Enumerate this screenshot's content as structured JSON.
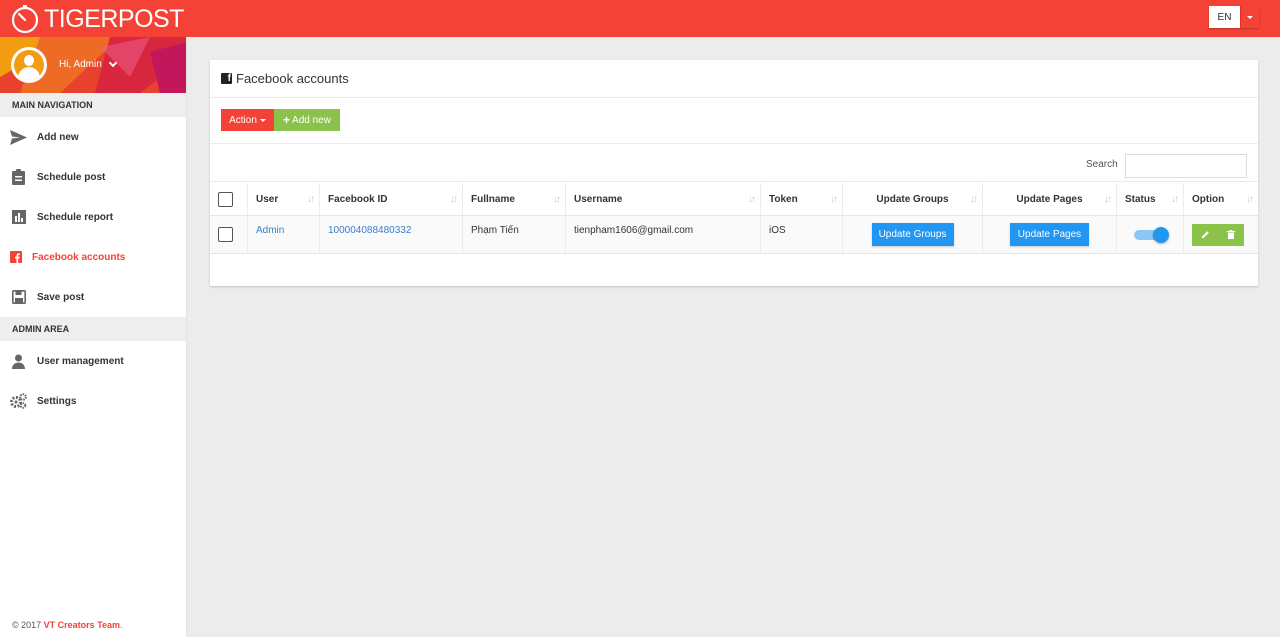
{
  "app": {
    "logo_text": "TIGERPOST",
    "language": "EN"
  },
  "user": {
    "greeting": "Hi, Admin"
  },
  "sidebar": {
    "main_header": "MAIN NAVIGATION",
    "main_items": [
      {
        "label": "Add new",
        "icon": "paper-plane-icon"
      },
      {
        "label": "Schedule post",
        "icon": "clipboard-icon"
      },
      {
        "label": "Schedule report",
        "icon": "bar-chart-icon"
      },
      {
        "label": "Facebook accounts",
        "icon": "facebook-icon",
        "active": true
      },
      {
        "label": "Save post",
        "icon": "floppy-disk-icon"
      }
    ],
    "admin_header": "ADMIN AREA",
    "admin_items": [
      {
        "label": "User management",
        "icon": "user-icon"
      },
      {
        "label": "Settings",
        "icon": "gears-icon"
      }
    ],
    "footer_prefix": "© 2017",
    "footer_brand": "VT Creators Team",
    "footer_suffix": "."
  },
  "page": {
    "title": "Facebook accounts",
    "action_label": "Action",
    "add_new_label": "Add new",
    "search_label": "Search",
    "search_value": ""
  },
  "table": {
    "columns": [
      "User",
      "Facebook ID",
      "Fullname",
      "Username",
      "Token",
      "Update Groups",
      "Update Pages",
      "Status",
      "Option"
    ],
    "rows": [
      {
        "user": "Admin",
        "facebook_id": "100004088480332",
        "fullname": "Phạm Tiến",
        "username": "tienpham1606@gmail.com",
        "token": "iOS",
        "update_groups": "Update Groups",
        "update_pages": "Update Pages",
        "status": true
      }
    ]
  },
  "colors": {
    "brand": "#f44336",
    "success": "#8bc34a",
    "primary": "#2196f3"
  }
}
